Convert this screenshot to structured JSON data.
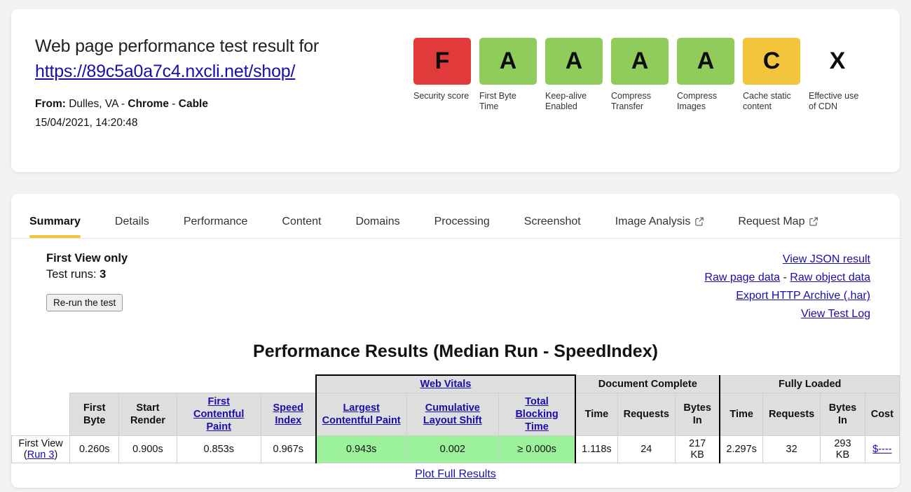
{
  "header": {
    "title": "Web page performance test result for",
    "url": "https://89c5a0a7c4.nxcli.net/shop/",
    "from_label": "From:",
    "from_location": "Dulles, VA",
    "sep1": "-",
    "browser": "Chrome",
    "sep2": "-",
    "connection": "Cable",
    "timestamp": "15/04/2021, 14:20:48"
  },
  "grades": [
    {
      "letter": "F",
      "label": "Security score",
      "color": "#e03a3a"
    },
    {
      "letter": "A",
      "label": "First Byte Time",
      "color": "#90cc5c"
    },
    {
      "letter": "A",
      "label": "Keep-alive Enabled",
      "color": "#90cc5c"
    },
    {
      "letter": "A",
      "label": "Compress Transfer",
      "color": "#90cc5c"
    },
    {
      "letter": "A",
      "label": "Compress Images",
      "color": "#90cc5c"
    },
    {
      "letter": "C",
      "label": "Cache static content",
      "color": "#f2c53d"
    },
    {
      "letter": "X",
      "label": "Effective use of CDN",
      "color": "none"
    }
  ],
  "tabs": [
    {
      "label": "Summary",
      "active": true,
      "external": false
    },
    {
      "label": "Details",
      "active": false,
      "external": false
    },
    {
      "label": "Performance",
      "active": false,
      "external": false
    },
    {
      "label": "Content",
      "active": false,
      "external": false
    },
    {
      "label": "Domains",
      "active": false,
      "external": false
    },
    {
      "label": "Processing",
      "active": false,
      "external": false
    },
    {
      "label": "Screenshot",
      "active": false,
      "external": false
    },
    {
      "label": "Image Analysis",
      "active": false,
      "external": true
    },
    {
      "label": "Request Map",
      "active": false,
      "external": true
    }
  ],
  "summary": {
    "view_label": "First View only",
    "runs_label": "Test runs:",
    "runs_value": "3",
    "rerun_button": "Re-run the test",
    "links": {
      "view_json": "View JSON result",
      "raw_page": "Raw page data",
      "raw_sep": "-",
      "raw_object": "Raw object data",
      "export_har": "Export HTTP Archive (.har)",
      "view_log": "View Test Log"
    }
  },
  "results": {
    "title": "Performance Results (Median Run - SpeedIndex)",
    "group_headers": {
      "web_vitals": "Web Vitals",
      "document_complete": "Document Complete",
      "fully_loaded": "Fully Loaded"
    },
    "columns": {
      "first_byte": "First Byte",
      "start_render": "Start Render",
      "first_contentful_paint": "First Contentful Paint",
      "speed_index": "Speed Index",
      "largest_contentful_paint": "Largest Contentful Paint",
      "cumulative_layout_shift": "Cumulative Layout Shift",
      "total_blocking_time": "Total Blocking Time",
      "dc_time": "Time",
      "dc_requests": "Requests",
      "dc_bytes_in": "Bytes In",
      "fl_time": "Time",
      "fl_requests": "Requests",
      "fl_bytes_in": "Bytes In",
      "fl_cost": "Cost"
    },
    "row": {
      "label_prefix": "First View (",
      "label_link": "Run 3",
      "label_suffix": ")",
      "first_byte": "0.260s",
      "start_render": "0.900s",
      "first_contentful_paint": "0.853s",
      "speed_index": "0.967s",
      "largest_contentful_paint": "0.943s",
      "cumulative_layout_shift": "0.002",
      "total_blocking_time": "≥ 0.000s",
      "dc_time": "1.118s",
      "dc_requests": "24",
      "dc_bytes_in": "217 KB",
      "fl_time": "2.297s",
      "fl_requests": "32",
      "fl_bytes_in": "293 KB",
      "fl_cost": "$----"
    },
    "plot_link": "Plot Full Results"
  }
}
